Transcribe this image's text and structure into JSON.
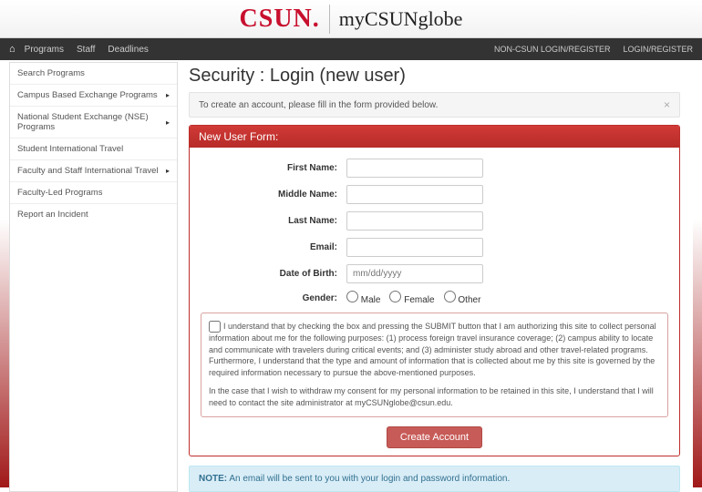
{
  "header": {
    "logo_left": "CSUN",
    "logo_dot": ".",
    "logo_right": "myCSUNglobe"
  },
  "topnav": {
    "items": [
      "Programs",
      "Staff",
      "Deadlines"
    ],
    "right": [
      "NON-CSUN LOGIN/REGISTER",
      "LOGIN/REGISTER"
    ]
  },
  "sidebar": {
    "items": [
      {
        "label": "Search Programs",
        "caret": false
      },
      {
        "label": "Campus Based Exchange Programs",
        "caret": true
      },
      {
        "label": "National Student Exchange (NSE) Programs",
        "caret": true
      },
      {
        "label": "Student International Travel",
        "caret": false
      },
      {
        "label": "Faculty and Staff International Travel",
        "caret": true
      },
      {
        "label": "Faculty-Led Programs",
        "caret": false
      },
      {
        "label": "Report an Incident",
        "caret": false
      }
    ]
  },
  "main": {
    "title": "Security : Login (new user)",
    "alert": "To create an account, please fill in the form provided below.",
    "panel_title": "New User Form:",
    "fields": {
      "first_name": "First Name:",
      "middle_name": "Middle Name:",
      "last_name": "Last Name:",
      "email": "Email:",
      "dob": "Date of Birth:",
      "dob_placeholder": "mm/dd/yyyy",
      "gender": "Gender:",
      "gender_opts": [
        "Male",
        "Female",
        "Other"
      ]
    },
    "consent_text": "I understand that by checking the box and pressing the SUBMIT button that I am authorizing this site to collect personal information about me for the following purposes: (1) process foreign travel insurance coverage; (2) campus ability to locate and communicate with travelers during critical events; and (3) administer study abroad and other travel-related programs. Furthermore, I understand that the type and amount of information that is collected about me by this site is governed by the required information necessary to pursue the above-mentioned purposes.",
    "consent_text2": "In the case that I wish to withdraw my consent for my personal information to be retained in this site, I understand that I will need to contact the site administrator at myCSUNglobe@csun.edu.",
    "submit_label": "Create Account",
    "note_label": "NOTE:",
    "note_text": " An email will be sent to you with your login and password information."
  }
}
